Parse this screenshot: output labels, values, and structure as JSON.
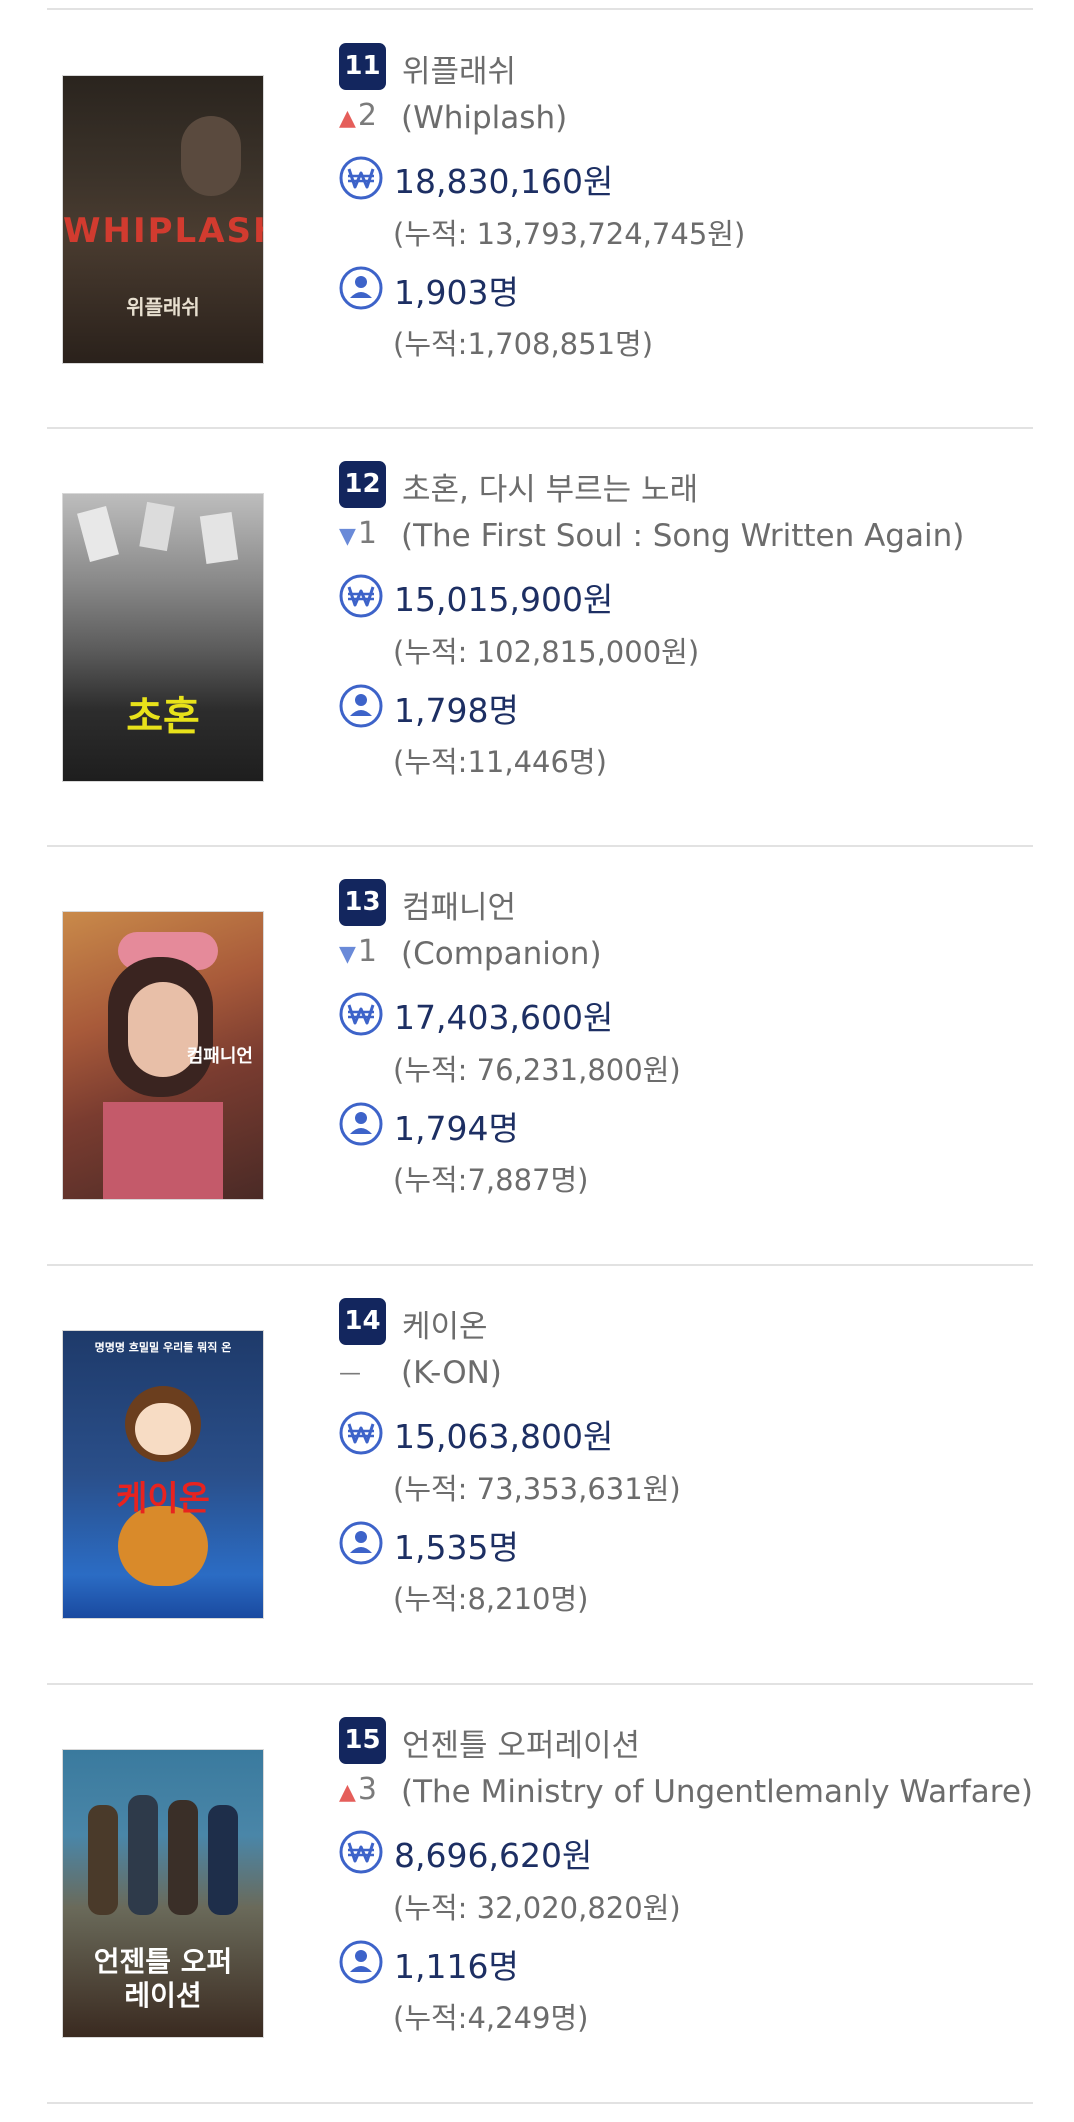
{
  "items": [
    {
      "rank": "11",
      "title_ko": "위플래쉬",
      "change_dir": "up",
      "change_value": "2",
      "title_en": "(Whiplash)",
      "sales": "18,830,160원",
      "sales_total": "(누적: 13,793,724,745원)",
      "audience": "1,903명",
      "audience_total": "(누적:1,708,851명)",
      "poster_text": "WHIPLASH",
      "poster_subtext": "위플래쉬"
    },
    {
      "rank": "12",
      "title_ko": "초혼, 다시 부르는 노래",
      "change_dir": "down",
      "change_value": "1",
      "title_en": "(The First Soul : Song Written Again)",
      "sales": "15,015,900원",
      "sales_total": "(누적: 102,815,000원)",
      "audience": "1,798명",
      "audience_total": "(누적:11,446명)",
      "poster_text": "초혼",
      "poster_subtext": ""
    },
    {
      "rank": "13",
      "title_ko": "컴패니언",
      "change_dir": "down",
      "change_value": "1",
      "title_en": "(Companion)",
      "sales": "17,403,600원",
      "sales_total": "(누적: 76,231,800원)",
      "audience": "1,794명",
      "audience_total": "(누적:7,887명)",
      "poster_text": "컴패니언",
      "poster_subtext": ""
    },
    {
      "rank": "14",
      "title_ko": "케이온",
      "change_dir": "none",
      "change_value": "—",
      "title_en": "(K-ON)",
      "sales": "15,063,800원",
      "sales_total": "(누적: 73,353,631원)",
      "audience": "1,535명",
      "audience_total": "(누적:8,210명)",
      "poster_text": "케이온",
      "poster_subtext": "명명명 흐밀밀 우리들 뭐직 온"
    },
    {
      "rank": "15",
      "title_ko": "언젠틀 오퍼레이션",
      "change_dir": "up",
      "change_value": "3",
      "title_en": "(The Ministry of Ungentlemanly Warfare)",
      "sales": "8,696,620원",
      "sales_total": "(누적: 32,020,820원)",
      "audience": "1,116명",
      "audience_total": "(누적:4,249명)",
      "poster_text": "언젠틀 오퍼레이션",
      "poster_subtext": ""
    }
  ],
  "arrows": {
    "up": "▲",
    "down": "▼",
    "none": ""
  },
  "colors": {
    "badge": "#13265e",
    "value_text": "#1d2f63",
    "up_arrow": "#e55e5a",
    "down_arrow": "#6a8ad8",
    "icon_blue": "#3d63c9"
  },
  "icons": {
    "sales": "won-icon",
    "audience": "person-icon"
  }
}
